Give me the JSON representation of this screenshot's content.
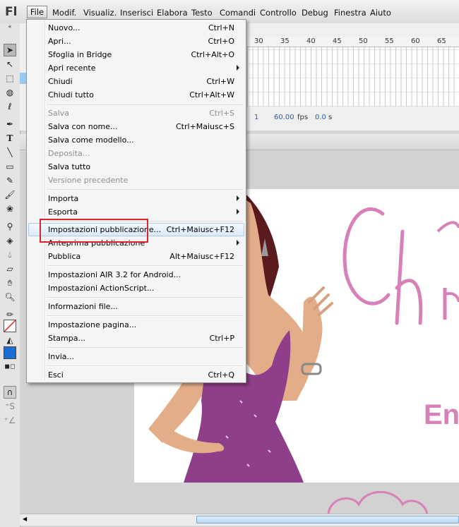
{
  "app": {
    "logo": "Fl"
  },
  "menubar": {
    "items": [
      "File",
      "Modif.",
      "Visualiz.",
      "Inserisci",
      "Elabora",
      "Testo",
      "Comandi",
      "Controllo",
      "Debug",
      "Finestra",
      "Aiuto"
    ]
  },
  "timeline": {
    "ruler": [
      "30",
      "35",
      "40",
      "45",
      "50",
      "55",
      "60",
      "65"
    ],
    "status": {
      "frame": "1",
      "fps": "60.00",
      "fps_unit": "fps",
      "time": "0.0",
      "time_unit": "s"
    }
  },
  "file_menu": {
    "items": [
      {
        "label": "Nuovo...",
        "shortcut": "Ctrl+N",
        "enabled": true
      },
      {
        "label": "Apri...",
        "shortcut": "Ctrl+O",
        "enabled": true
      },
      {
        "label": "Sfoglia in Bridge",
        "shortcut": "Ctrl+Alt+O",
        "enabled": true
      },
      {
        "label": "Apri recente",
        "shortcut": "",
        "enabled": true,
        "submenu": true
      },
      {
        "label": "Chiudi",
        "shortcut": "Ctrl+W",
        "enabled": true
      },
      {
        "label": "Chiudi tutto",
        "shortcut": "Ctrl+Alt+W",
        "enabled": true
      },
      {
        "label": "Salva",
        "shortcut": "Ctrl+S",
        "enabled": false
      },
      {
        "label": "Salva con nome...",
        "shortcut": "Ctrl+Maiusc+S",
        "enabled": true
      },
      {
        "label": "Salva come modello...",
        "shortcut": "",
        "enabled": true
      },
      {
        "label": "Deposita...",
        "shortcut": "",
        "enabled": false
      },
      {
        "label": "Salva tutto",
        "shortcut": "",
        "enabled": true
      },
      {
        "label": "Versione precedente",
        "shortcut": "",
        "enabled": false
      },
      {
        "label": "Importa",
        "shortcut": "",
        "enabled": true,
        "submenu": true
      },
      {
        "label": "Esporta",
        "shortcut": "",
        "enabled": true,
        "submenu": true
      },
      {
        "label": "Impostazioni pubblicazione...",
        "shortcut": "Ctrl+Maiusc+F12",
        "enabled": true,
        "highlighted": true
      },
      {
        "label": "Anteprima pubblicazione",
        "shortcut": "",
        "enabled": true,
        "submenu": true
      },
      {
        "label": "Pubblica",
        "shortcut": "Alt+Maiusc+F12",
        "enabled": true
      },
      {
        "label": "Impostazioni AIR 3.2 for Android...",
        "shortcut": "",
        "enabled": true
      },
      {
        "label": "Impostazioni ActionScript...",
        "shortcut": "",
        "enabled": true
      },
      {
        "label": "Informazioni file...",
        "shortcut": "",
        "enabled": true
      },
      {
        "label": "Impostazione pagina...",
        "shortcut": "",
        "enabled": true
      },
      {
        "label": "Stampa...",
        "shortcut": "Ctrl+P",
        "enabled": true
      },
      {
        "label": "Invia...",
        "shortcut": "",
        "enabled": true
      },
      {
        "label": "Esci",
        "shortcut": "Ctrl+Q",
        "enabled": true
      }
    ]
  },
  "stage_artwork": {
    "letters": "Chi",
    "partial_word": "En",
    "accent": "#d880b8",
    "dress": "#8f3f8a"
  },
  "colors": {
    "highlight_box": "#d9232e",
    "menu_hover": "#dbeafb"
  }
}
